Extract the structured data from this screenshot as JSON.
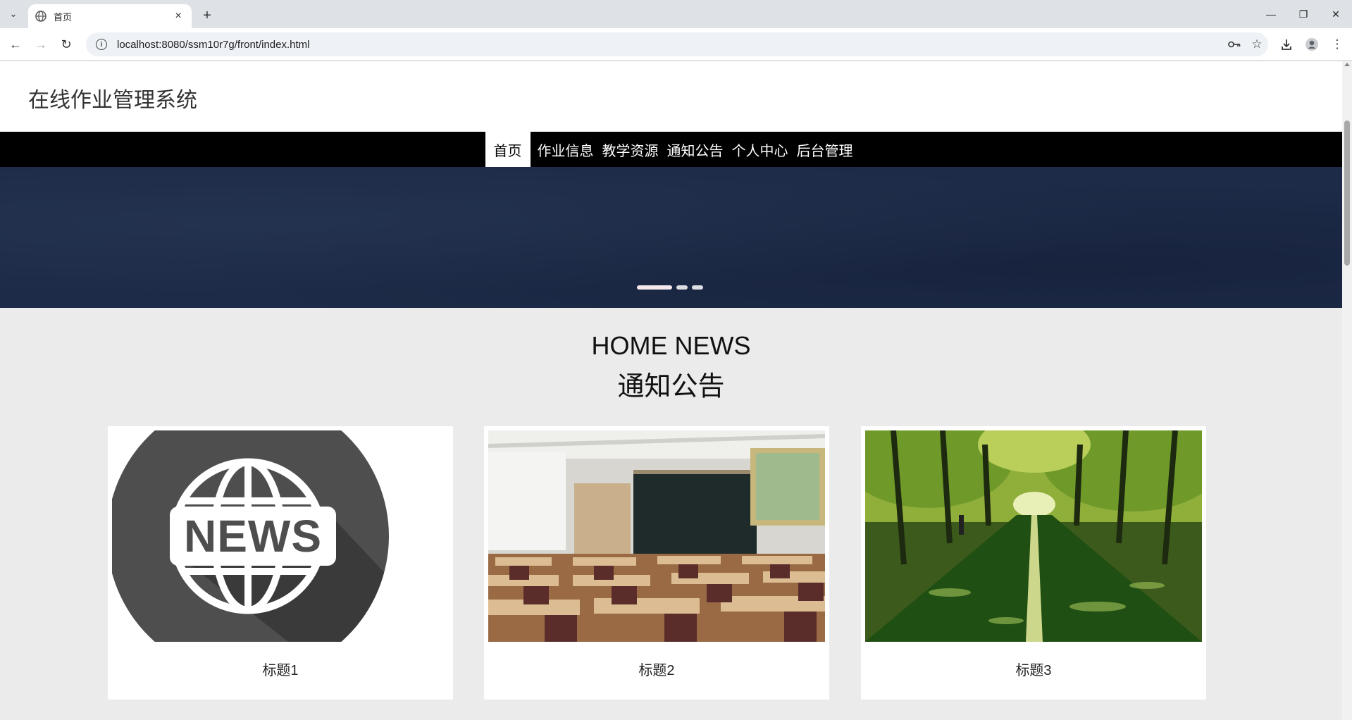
{
  "browser": {
    "tab_title": "首页",
    "new_tab_label": "+",
    "url": "localhost:8080/ssm10r7g/front/index.html"
  },
  "site": {
    "title": "在线作业管理系统"
  },
  "nav": {
    "items": [
      {
        "label": "首页",
        "active": true
      },
      {
        "label": "作业信息",
        "active": false
      },
      {
        "label": "教学资源",
        "active": false
      },
      {
        "label": "通知公告",
        "active": false
      },
      {
        "label": "个人中心",
        "active": false
      },
      {
        "label": "后台管理",
        "active": false
      }
    ]
  },
  "banner": {
    "slide_count": 3,
    "active_slide": 1
  },
  "news": {
    "title_en": "HOME NEWS",
    "title_cn": "通知公告",
    "cards": [
      {
        "title": "标题1",
        "image": "news-globe-image",
        "logo_text": "NEWS"
      },
      {
        "title": "标题2",
        "image": "classroom-image"
      },
      {
        "title": "标题3",
        "image": "tree-lined-road-image"
      }
    ]
  },
  "colors": {
    "navbar_bg": "#000000",
    "banner_bg": "#1d2b48",
    "page_bg": "#ebebeb"
  }
}
